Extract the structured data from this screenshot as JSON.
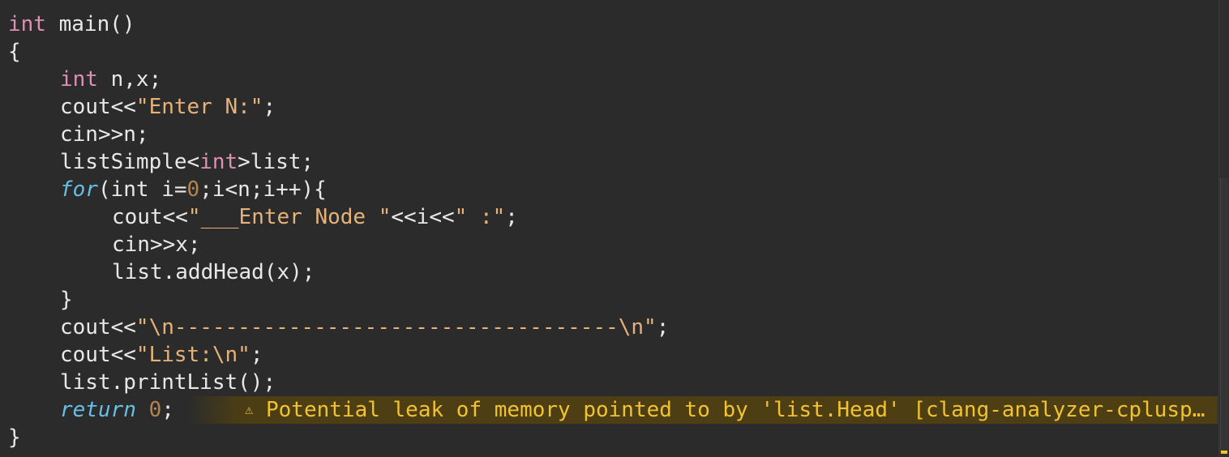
{
  "code": {
    "l1_kw": "int",
    "l1_rest": " main()",
    "l2": "{",
    "l3_kw": "int",
    "l3_rest": " n,x;",
    "l4_a": "cout<<",
    "l4_str": "\"Enter N:\"",
    "l4_b": ";",
    "l5": "cin>>n;",
    "l6_a": "listSimple<",
    "l6_kw": "int",
    "l6_b": ">list;",
    "l7_for": "for",
    "l7_a": "(int i=",
    "l7_num": "0",
    "l7_b": ";i<n;i++){",
    "l8_a": "cout<<",
    "l8_str": "\"___Enter Node \"",
    "l8_b": "<<i<<",
    "l8_str2": "\" :\"",
    "l8_c": ";",
    "l9": "cin>>x;",
    "l10": "list.addHead(x);",
    "l11": "}",
    "l12_a": "cout<<",
    "l12_str": "\"\\n-----------------------------------\\n\"",
    "l12_b": ";",
    "l13_a": "cout<<",
    "l13_str": "\"List:\\n\"",
    "l13_b": ";",
    "l14": "list.printList();",
    "l15_return": "return",
    "l15_num": " 0",
    "l15_b": ";",
    "l16": "}"
  },
  "diagnostic": {
    "icon": "warning-icon",
    "glyph": "⚠",
    "message": "Potential leak of memory pointed to by 'list.Head' [clang-analyzer-cplusplus.NewDeleteLeaks]"
  },
  "colors": {
    "background": "#2b2b2b",
    "keyword": "#dd8fb4",
    "control_keyword": "#66c0e6",
    "string": "#e6b27a",
    "number": "#b3844d",
    "warning": "#f1c232",
    "warning_bg": "#4d3f13"
  }
}
